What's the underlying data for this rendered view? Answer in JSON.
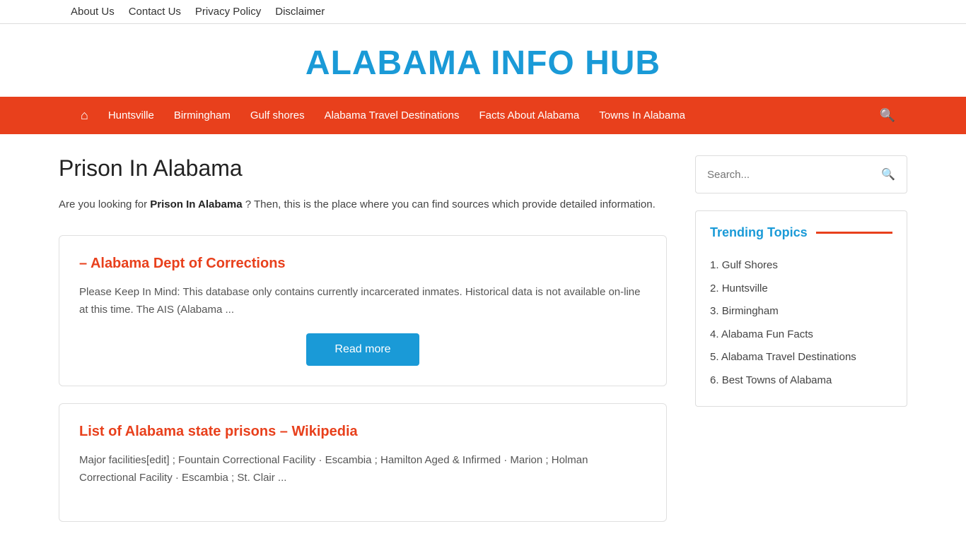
{
  "top_nav": {
    "links": [
      {
        "label": "About Us",
        "name": "about-us"
      },
      {
        "label": "Contact Us",
        "name": "contact-us"
      },
      {
        "label": "Privacy Policy",
        "name": "privacy-policy"
      },
      {
        "label": "Disclaimer",
        "name": "disclaimer"
      }
    ]
  },
  "site": {
    "title": "ALABAMA INFO HUB"
  },
  "main_nav": {
    "home_icon": "⌂",
    "links": [
      {
        "label": "Huntsville",
        "name": "nav-huntsville"
      },
      {
        "label": "Birmingham",
        "name": "nav-birmingham"
      },
      {
        "label": "Gulf shores",
        "name": "nav-gulf-shores"
      },
      {
        "label": "Alabama Travel Destinations",
        "name": "nav-travel"
      },
      {
        "label": "Facts About Alabama",
        "name": "nav-facts"
      },
      {
        "label": "Towns In Alabama",
        "name": "nav-towns"
      }
    ],
    "search_icon": "🔍"
  },
  "page": {
    "title": "Prison In Alabama",
    "intro": "Are you looking for ",
    "intro_bold": "Prison In Alabama",
    "intro_rest": " ? Then, this is the place where you can find sources which provide detailed information."
  },
  "articles": [
    {
      "title": "– Alabama Dept of Corrections",
      "excerpt": "Please Keep In Mind: This database only contains currently incarcerated inmates. Historical data is not available on-line at this time. The AIS (Alabama ...",
      "read_more": "Read more",
      "name": "article-corrections"
    },
    {
      "title": "List of Alabama state prisons – Wikipedia",
      "excerpt": "Major facilities[edit] ; Fountain Correctional Facility · Escambia ; Hamilton Aged & Infirmed · Marion ; Holman Correctional Facility · Escambia ; St. Clair ...",
      "name": "article-wikipedia"
    }
  ],
  "sidebar": {
    "search": {
      "placeholder": "Search...",
      "button_icon": "🔍"
    },
    "trending": {
      "title": "Trending Topics",
      "items": [
        {
          "number": "1.",
          "label": "Gulf Shores"
        },
        {
          "number": "2.",
          "label": "Huntsville"
        },
        {
          "number": "3.",
          "label": "Birmingham"
        },
        {
          "number": "4.",
          "label": "Alabama Fun Facts"
        },
        {
          "number": "5.",
          "label": "Alabama Travel Destinations"
        },
        {
          "number": "6.",
          "label": "Best Towns of Alabama"
        }
      ]
    }
  }
}
